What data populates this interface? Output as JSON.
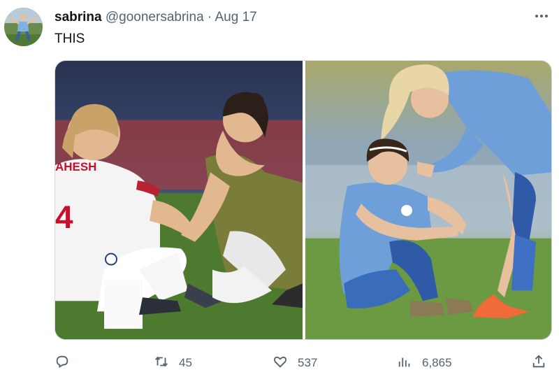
{
  "tweet": {
    "display_name": "sabrina",
    "handle": "@goonersabrina",
    "separator": "·",
    "date": "Aug 17",
    "text": "THIS",
    "more_icon": "more-dots-icon"
  },
  "media": {
    "left_photo": {
      "jersey_text": "AHESH",
      "jersey_number": "4"
    },
    "right_photo": {}
  },
  "actions": {
    "reply": {
      "icon": "reply-icon",
      "count": ""
    },
    "retweet": {
      "icon": "retweet-icon",
      "count": "45"
    },
    "like": {
      "icon": "heart-icon",
      "count": "537"
    },
    "views": {
      "icon": "views-icon",
      "count": "6,865"
    },
    "share": {
      "icon": "share-icon",
      "count": ""
    }
  },
  "colors": {
    "text_primary": "#0f1419",
    "text_secondary": "#536471",
    "accent_red": "#d0202e"
  }
}
